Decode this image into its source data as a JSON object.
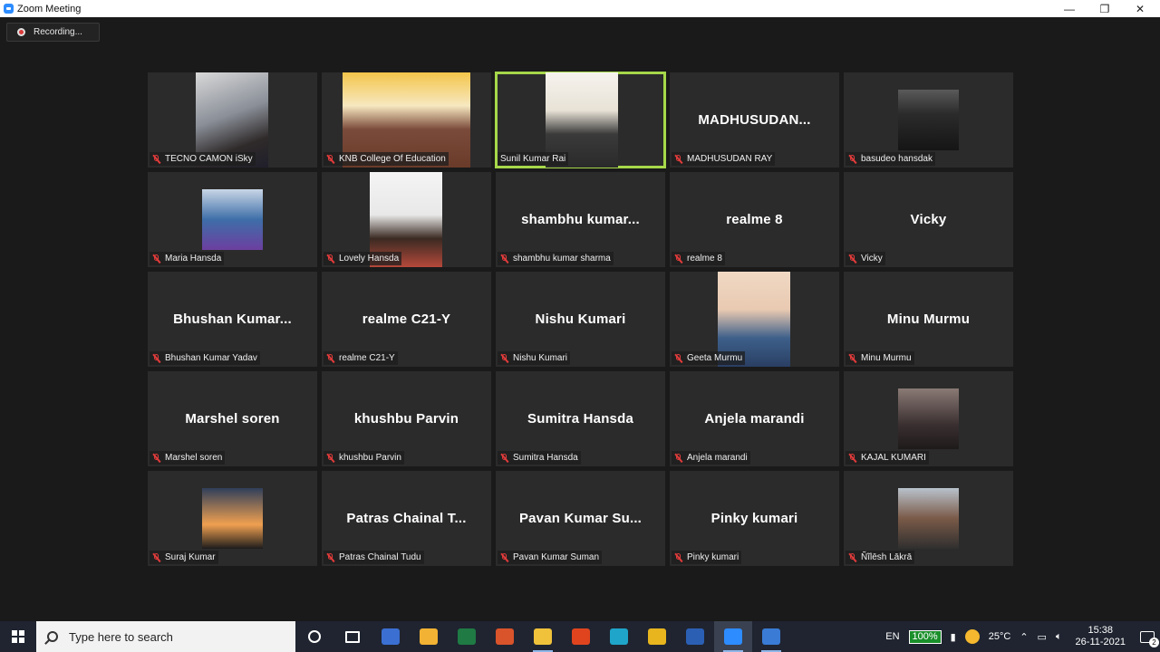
{
  "window": {
    "title": "Zoom Meeting",
    "minimize": "—",
    "restore": "❐",
    "close": "✕"
  },
  "recording": {
    "label": "Recording..."
  },
  "participants": [
    {
      "id": "p1",
      "display": "TECNO CAMON iSky",
      "name": "TECNO CAMON iSky",
      "muted": true,
      "video": true
    },
    {
      "id": "p2",
      "display": "KNB College Of Education",
      "name": "KNB College Of Education",
      "muted": true,
      "video": true
    },
    {
      "id": "p3",
      "display": "Sunil Kumar Rai",
      "name": "Sunil Kumar Rai",
      "muted": false,
      "video": true,
      "active_speaker": true
    },
    {
      "id": "p4",
      "display": "MADHUSUDAN...",
      "name": "MADHUSUDAN RAY",
      "muted": true,
      "video": false
    },
    {
      "id": "p5",
      "display": "basudeo hansdak",
      "name": "basudeo hansdak",
      "muted": true,
      "video": true
    },
    {
      "id": "p6",
      "display": "Maria Hansda",
      "name": "Maria Hansda",
      "muted": true,
      "video": true
    },
    {
      "id": "p7",
      "display": "Lovely Hansda",
      "name": "Lovely Hansda",
      "muted": true,
      "video": true
    },
    {
      "id": "p8",
      "display": "shambhu  kumar...",
      "name": "shambhu kumar sharma",
      "muted": true,
      "video": false
    },
    {
      "id": "p9",
      "display": "realme 8",
      "name": "realme 8",
      "muted": true,
      "video": false
    },
    {
      "id": "p10",
      "display": "Vicky",
      "name": "Vicky",
      "muted": true,
      "video": false
    },
    {
      "id": "p11",
      "display": "Bhushan  Kumar...",
      "name": "Bhushan Kumar Yadav",
      "muted": true,
      "video": false
    },
    {
      "id": "p12",
      "display": "realme C21-Y",
      "name": "realme C21-Y",
      "muted": true,
      "video": false
    },
    {
      "id": "p13",
      "display": "Nishu Kumari",
      "name": "Nishu Kumari",
      "muted": true,
      "video": false
    },
    {
      "id": "p14",
      "display": "Geeta Murmu",
      "name": "Geeta Murmu",
      "muted": true,
      "video": true
    },
    {
      "id": "p15",
      "display": "Minu Murmu",
      "name": "Minu Murmu",
      "muted": true,
      "video": false
    },
    {
      "id": "p16",
      "display": "Marshel soren",
      "name": "Marshel soren",
      "muted": true,
      "video": false
    },
    {
      "id": "p17",
      "display": "khushbu Parvin",
      "name": "khushbu Parvin",
      "muted": true,
      "video": false
    },
    {
      "id": "p18",
      "display": "Sumitra Hansda",
      "name": "Sumitra Hansda",
      "muted": true,
      "video": false
    },
    {
      "id": "p19",
      "display": "Anjela marandi",
      "name": "Anjela marandi",
      "muted": true,
      "video": false
    },
    {
      "id": "p20",
      "display": "KAJAL KUMARI",
      "name": "KAJAL KUMARI",
      "muted": true,
      "video": true
    },
    {
      "id": "p21",
      "display": "Suraj Kumar",
      "name": "Suraj Kumar",
      "muted": true,
      "video": true
    },
    {
      "id": "p22",
      "display": "Patras Chainal T...",
      "name": "Patras Chainal Tudu",
      "muted": true,
      "video": false
    },
    {
      "id": "p23",
      "display": "Pavan Kumar Su...",
      "name": "Pavan Kumar Suman",
      "muted": true,
      "video": false
    },
    {
      "id": "p24",
      "display": "Pinky kumari",
      "name": "Pinky kumari",
      "muted": true,
      "video": false
    },
    {
      "id": "p25",
      "display": "Ñĩlēsh Lākrā",
      "name": "Ñĩlēsh Lākrā",
      "muted": true,
      "video": true
    }
  ],
  "taskbar": {
    "search_placeholder": "Type here to search",
    "apps": [
      {
        "name": "cortana-icon",
        "color": ""
      },
      {
        "name": "task-view-icon",
        "color": ""
      },
      {
        "name": "app-blue-icon",
        "color": "#3b6fd1"
      },
      {
        "name": "store-icon",
        "color": "#f2b233"
      },
      {
        "name": "excel-icon",
        "color": "#1f7a44"
      },
      {
        "name": "acrobat-icon",
        "color": "#d9532b"
      },
      {
        "name": "file-explorer-icon",
        "color": "#f0c23b"
      },
      {
        "name": "office-icon",
        "color": "#e0441f"
      },
      {
        "name": "edge-icon",
        "color": "#1fa5c9"
      },
      {
        "name": "chrome-icon",
        "color": "#e8b51e"
      },
      {
        "name": "word-icon",
        "color": "#2b5fb4"
      },
      {
        "name": "zoom-icon",
        "color": "#2d8cff"
      },
      {
        "name": "app-pin-icon",
        "color": "#3a7bd5"
      }
    ],
    "tray": {
      "language": "EN",
      "battery": "100%",
      "temperature": "25°C",
      "time": "15:38",
      "date": "26-11-2021",
      "notifications": "2"
    }
  }
}
